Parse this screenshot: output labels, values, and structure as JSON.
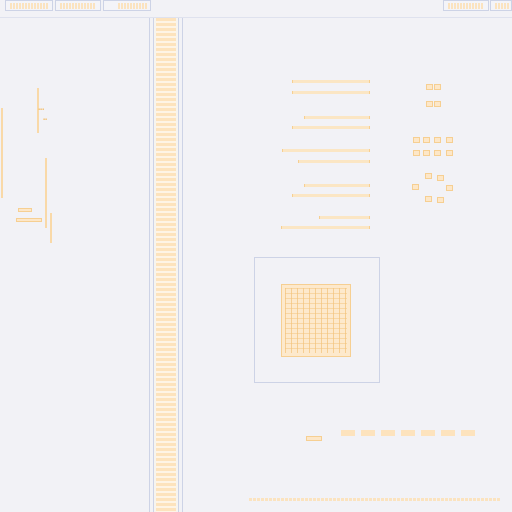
{
  "colors": {
    "background": "#f2f2f6",
    "panel_border": "#cdd3e6",
    "trace": "#f6cf92",
    "trace_fill": "#fde7c8",
    "accent": "#f3c37a"
  },
  "icons": {
    "tab_thumbnail": "thumbnail-icon",
    "chip_block": "chip-icon"
  },
  "scrollbar": {
    "orientation": "vertical"
  },
  "bottom_text": "",
  "chip_label": ""
}
